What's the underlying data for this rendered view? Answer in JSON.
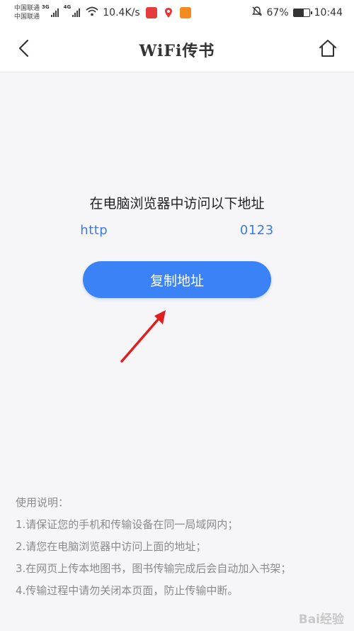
{
  "status_bar": {
    "carrier_1": "中国联通",
    "carrier_2": "中国联通",
    "net_1": "3G",
    "net_2": "4G",
    "speed": "10.4K/s",
    "battery_percent": "67%",
    "battery_level": 0.67,
    "time": "10:44"
  },
  "header": {
    "title": "WiFi传书"
  },
  "main": {
    "instruction": "在电脑浏览器中访问以下地址",
    "address": "http                              0123",
    "copy_button": "复制地址"
  },
  "usage": {
    "title": "使用说明：",
    "items": [
      "1.请保证您的手机和传输设备在同一局域网内；",
      "2.请您在电脑浏览器中访问上面的地址；",
      "3.在网页上传本地图书，图书传输完成后会自动加入书架；",
      "4.传输过程中请勿关闭本页面，防止传输中断。"
    ]
  },
  "watermark": "Bai经验",
  "colors": {
    "accent": "#3b82f6",
    "link": "#3d7be0",
    "arrow": "#e02020"
  }
}
